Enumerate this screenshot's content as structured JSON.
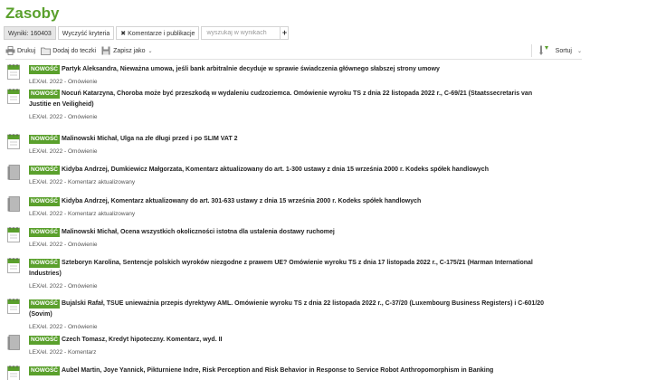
{
  "page_title": "Zasoby",
  "filters": {
    "results_label": "Wyniki: 160403",
    "clear_label": "Wyczyść kryteria",
    "criterion_label": "Komentarze i publikacje",
    "search_placeholder": "wyszukaj w wynikach",
    "add_label": "+"
  },
  "toolbar": {
    "print_label": "Drukuj",
    "add_folder_label": "Dodaj do teczki",
    "save_as_label": "Zapisz jako",
    "sort_label": "Sortuj"
  },
  "badge_label": "NOWOŚĆ",
  "results": [
    {
      "title": "Partyk Aleksandra, Nieważna umowa, jeśli bank arbitralnie decyduje w sprawie świadczenia głównego słabszej strony umowy",
      "meta": "LEX/el. 2022 - Omówienie",
      "is_new": true,
      "icon": "note-icon"
    },
    {
      "title": "Nocuń Katarzyna, Choroba może być przeszkodą w wydaleniu cudzoziemca. Omówienie wyroku TS z dnia 22 listopada 2022 r., C-69/21 (Staatssecretaris van Justitie en Veiligheid)",
      "meta": "LEX/el. 2022 - Omówienie",
      "is_new": true,
      "icon": "note-icon"
    },
    {
      "title": "Malinowski Michał, Ulga na złe długi przed i po SLIM VAT 2",
      "meta": "LEX/el. 2022 - Omówienie",
      "is_new": true,
      "icon": "note-icon"
    },
    {
      "title": "Kidyba Andrzej, Dumkiewicz Małgorzata, Komentarz aktualizowany do art. 1-300 ustawy z dnia 15 września 2000 r. Kodeks spółek handlowych",
      "meta": "LEX/el. 2022 - Komentarz aktualizowany",
      "is_new": true,
      "icon": "book-icon"
    },
    {
      "title": "Kidyba Andrzej, Komentarz aktualizowany do art. 301-633 ustawy z dnia 15 września 2000 r. Kodeks spółek handlowych",
      "meta": "LEX/el. 2022 - Komentarz aktualizowany",
      "is_new": true,
      "icon": "book-icon"
    },
    {
      "title": "Malinowski Michał, Ocena wszystkich okoliczności istotna dla ustalenia dostawy ruchomej",
      "meta": "LEX/el. 2022 - Omówienie",
      "is_new": true,
      "icon": "note-icon"
    },
    {
      "title": "Szteboryn Karolina, Sentencje polskich wyroków niezgodne z prawem UE? Omówienie wyroku TS z dnia 17 listopada 2022 r., C-175/21 (Harman International Industries)",
      "meta": "LEX/el. 2022 - Omówienie",
      "is_new": true,
      "icon": "note-icon"
    },
    {
      "title": "Bujalski Rafał, TSUE unieważnia przepis dyrektywy AML. Omówienie wyroku TS z dnia 22 listopada 2022 r., C-37/20 (Luxembourg Business Registers) i C-601/20 (Sovim)",
      "meta": "LEX/el. 2022 - Omówienie",
      "is_new": true,
      "icon": "note-icon"
    },
    {
      "title": "Czech Tomasz, Kredyt hipoteczny. Komentarz, wyd. II",
      "meta": "LEX/el. 2022 - Komentarz",
      "is_new": true,
      "icon": "book-icon"
    },
    {
      "title": "Aubel Martin, Joye Yannick, Pikturniene Indre, Risk Perception and Risk Behavior in Response to Service Robot Anthropomorphism in Banking",
      "meta": "",
      "is_new": true,
      "icon": "note-icon"
    }
  ]
}
